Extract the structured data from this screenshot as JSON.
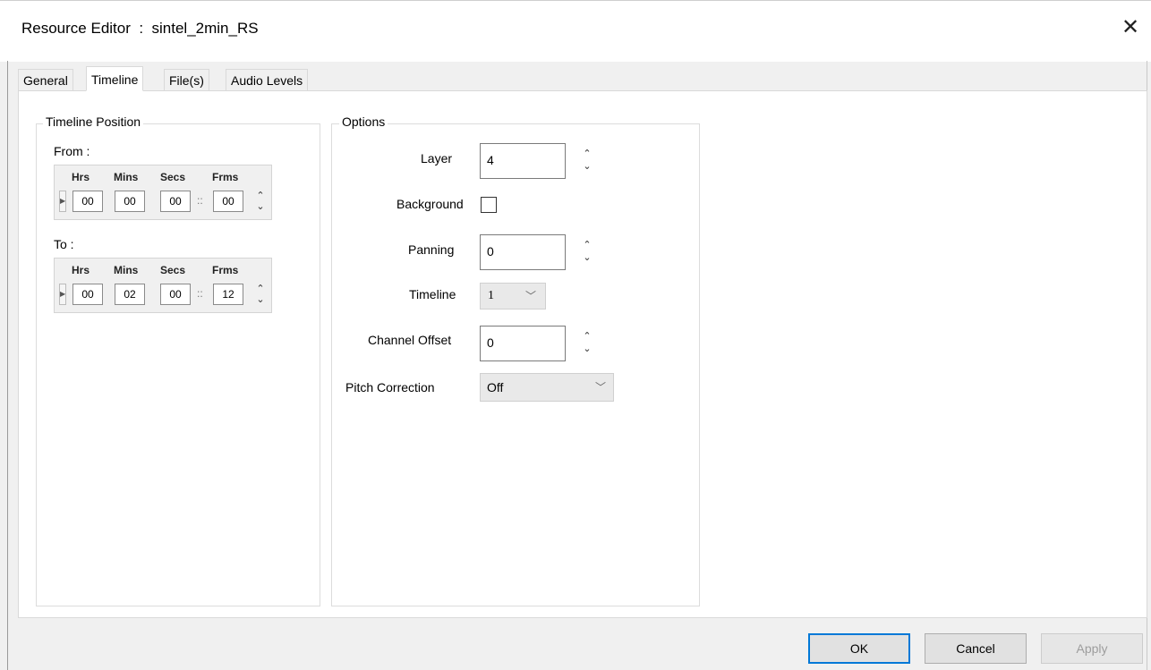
{
  "window": {
    "title": "Resource Editor  :  sintel_2min_RS",
    "close_glyph": "✕"
  },
  "tabs": [
    {
      "label": "General",
      "active": false
    },
    {
      "label": "Timeline",
      "active": true
    },
    {
      "label": "File(s)",
      "active": false
    },
    {
      "label": "Audio Levels",
      "active": false
    }
  ],
  "timeline_position": {
    "group_title": "Timeline Position",
    "headers": [
      "Hrs",
      "Mins",
      "Secs",
      "Frms"
    ],
    "from": {
      "label": "From :",
      "values": [
        "00",
        "00",
        "00",
        "00"
      ]
    },
    "to": {
      "label": "To :",
      "values": [
        "00",
        "02",
        "00",
        "12"
      ]
    },
    "sep": "::"
  },
  "options": {
    "group_title": "Options",
    "layer": {
      "label": "Layer",
      "value": "4"
    },
    "background": {
      "label": "Background",
      "checked": false
    },
    "panning": {
      "label": "Panning",
      "value": "0"
    },
    "timeline": {
      "label": "Timeline",
      "value": "1"
    },
    "channel_offset": {
      "label": "Channel Offset",
      "value": "0"
    },
    "pitch_correction": {
      "label": "Pitch Correction",
      "value": "Off"
    }
  },
  "buttons": {
    "ok": "OK",
    "cancel": "Cancel",
    "apply": "Apply"
  },
  "icons": {
    "spin_up": "⌃",
    "spin_down": "⌄",
    "dropdown": "﹀",
    "row_marker": "▶"
  }
}
